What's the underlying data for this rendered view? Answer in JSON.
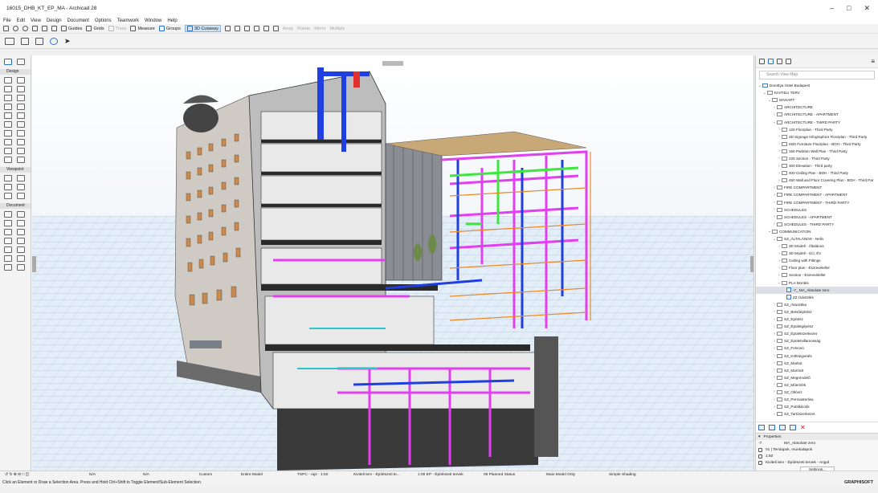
{
  "window": {
    "title": "16015_DHB_KT_EP_MA - Archicad 28"
  },
  "menu": [
    "File",
    "Edit",
    "View",
    "Design",
    "Document",
    "Options",
    "Teamwork",
    "Window",
    "Help"
  ],
  "toolbar": {
    "guides": "Guides",
    "grids": "Grids",
    "trace": "Trace",
    "measure": "Measure",
    "groups": "Groups",
    "cutaway": "3D Cutaway",
    "array": "Array",
    "rotate": "Rotate",
    "mirror": "Mirror",
    "multiply": "Multiply"
  },
  "toolbox": {
    "sections": [
      "Design",
      "Viewpoint",
      "Document"
    ]
  },
  "navigator": {
    "search_placeholder": "Search View Map",
    "items": [
      {
        "label": "Dorottya Hotel Budapest",
        "level": 0,
        "kind": "project",
        "expanded": true
      },
      {
        "label": "KIVITELI TERV",
        "level": 1,
        "kind": "folder",
        "expanded": true
      },
      {
        "label": "MAHART",
        "level": 2,
        "kind": "folder",
        "expanded": true
      },
      {
        "label": "ARCHITECTURE",
        "level": 3,
        "kind": "folder",
        "expanded": false
      },
      {
        "label": "ARCHITECTURE - APARTMENT",
        "level": 3,
        "kind": "folder",
        "expanded": false
      },
      {
        "label": "ARCHITECTURE - THIRD PARTY",
        "level": 3,
        "kind": "folder",
        "expanded": true
      },
      {
        "label": "120 Floorplan - Third Party",
        "level": 4,
        "kind": "folder",
        "expanded": false
      },
      {
        "label": "2D Signage Infographics Floorplan - Third Party",
        "level": 4,
        "kind": "folder",
        "expanded": false
      },
      {
        "label": "M20 Furniture Floorplan - BOH - Third Party",
        "level": 4,
        "kind": "folder",
        "expanded": false
      },
      {
        "label": "160 Partition Wall Plan - Third Party",
        "level": 4,
        "kind": "folder",
        "expanded": false
      },
      {
        "label": "225 Section - Third Party",
        "level": 4,
        "kind": "folder",
        "expanded": false
      },
      {
        "label": "300 Elevation - Third party",
        "level": 4,
        "kind": "folder",
        "expanded": false
      },
      {
        "label": "400 Ceiling Plan - BOH - Third Party",
        "level": 4,
        "kind": "folder",
        "expanded": false
      },
      {
        "label": "450 Wall and Floor Covering Plan - BOH - Third Par",
        "level": 4,
        "kind": "folder",
        "expanded": false
      },
      {
        "label": "FIRE COMPARTMENT",
        "level": 3,
        "kind": "folder",
        "expanded": false
      },
      {
        "label": "FIRE COMPARTMENT - APARTMENT",
        "level": 3,
        "kind": "folder",
        "expanded": false
      },
      {
        "label": "FIRE COMPARTMENT - THIRD PARTY",
        "level": 3,
        "kind": "folder",
        "expanded": false
      },
      {
        "label": "SCHEDULES",
        "level": 3,
        "kind": "folder",
        "expanded": false
      },
      {
        "label": "SCHEDULES - APARTMENT",
        "level": 3,
        "kind": "folder",
        "expanded": false
      },
      {
        "label": "SCHEDULES - THIRD PARTY",
        "level": 3,
        "kind": "folder",
        "expanded": false
      },
      {
        "label": "COMMUNICATION",
        "level": 2,
        "kind": "folder",
        "expanded": true
      },
      {
        "label": "SZ_ÁLTALÁNOS - Nelív",
        "level": 3,
        "kind": "folder",
        "expanded": true
      },
      {
        "label": "3D Modell - Általános",
        "level": 4,
        "kind": "folder",
        "expanded": false
      },
      {
        "label": "3D Modell - GÜ, ÉV",
        "level": 4,
        "kind": "folder",
        "expanded": false
      },
      {
        "label": "Ceiling with Fittings",
        "level": 4,
        "kind": "folder",
        "expanded": false
      },
      {
        "label": "Floor plan - Észrevétellel",
        "level": 4,
        "kind": "folder",
        "expanded": false
      },
      {
        "label": "Section - Észrevétellel",
        "level": 4,
        "kind": "folder",
        "expanded": false
      },
      {
        "label": "PLA Montés",
        "level": 4,
        "kind": "folder",
        "expanded": true
      },
      {
        "label": "-7_ MA_Absolute zero",
        "level": 5,
        "kind": "view",
        "expanded": false,
        "selected": true
      },
      {
        "label": "ZZ Üdvözlés",
        "level": 5,
        "kind": "view",
        "expanded": false
      },
      {
        "label": "SZ_Akusztika",
        "level": 3,
        "kind": "folder",
        "expanded": false
      },
      {
        "label": "SZ_Belsőépítész",
        "level": 3,
        "kind": "folder",
        "expanded": false
      },
      {
        "label": "SZ_Építész",
        "level": 3,
        "kind": "folder",
        "expanded": false
      },
      {
        "label": "SZ_Épületgépész",
        "level": 3,
        "kind": "folder",
        "expanded": false
      },
      {
        "label": "SZ_Épületszerkezet",
        "level": 3,
        "kind": "folder",
        "expanded": false
      },
      {
        "label": "SZ_Épületvillamosság",
        "level": 3,
        "kind": "folder",
        "expanded": false
      },
      {
        "label": "SZ_Felvonó",
        "level": 3,
        "kind": "folder",
        "expanded": false
      },
      {
        "label": "SZ_Költségvetés",
        "level": 3,
        "kind": "folder",
        "expanded": false
      },
      {
        "label": "SZ_Markot",
        "level": 3,
        "kind": "folder",
        "expanded": false
      },
      {
        "label": "SZ_Marriott",
        "level": 3,
        "kind": "folder",
        "expanded": false
      },
      {
        "label": "SZ_Megrendelő",
        "level": 3,
        "kind": "folder",
        "expanded": false
      },
      {
        "label": "SZ_Műemlék",
        "level": 3,
        "kind": "folder",
        "expanded": false
      },
      {
        "label": "SZ_Oltóvíz",
        "level": 3,
        "kind": "folder",
        "expanded": false
      },
      {
        "label": "SZ_Permasterlisa",
        "level": 3,
        "kind": "folder",
        "expanded": false
      },
      {
        "label": "SZ_Publikációk",
        "level": 3,
        "kind": "folder",
        "expanded": false
      },
      {
        "label": "SZ_Tartószerkezet",
        "level": 3,
        "kind": "folder",
        "expanded": false
      }
    ]
  },
  "properties": {
    "header": "Properties",
    "id": "-7.",
    "name": "MA_Absolute zero",
    "layer_combo": "01 | Tervlapok, munkalapok",
    "scale": "1:50",
    "mvo": "Kiviteli terv - Építészeti tervek - Angol",
    "settings_button": "Settings..."
  },
  "statusbar": {
    "na1": "N/A",
    "na2": "N/A",
    "custom": "Custom",
    "entire_model": "Entire Model",
    "layer": "TSPC - rajz - 1:50",
    "pen": "Kiviteli terv - Építészeti te...",
    "structure": "1:00 EP - Építészeti tervek",
    "renovation": "06 Planned Status",
    "model": "Main Model Only",
    "shading": "Simple Shading"
  },
  "hint": "Click an Element or Draw a Selection Area. Press and Hold Ctrl+Shift to Toggle Element/Sub-Element Selection.",
  "brand": "GRAPHISOFT",
  "colors": {
    "accent": "#2a6fc9",
    "selection": "#dce0e6",
    "mep_magenta": "#e040f0",
    "mep_blue": "#1f3fe0",
    "mep_green": "#3ee63e"
  }
}
